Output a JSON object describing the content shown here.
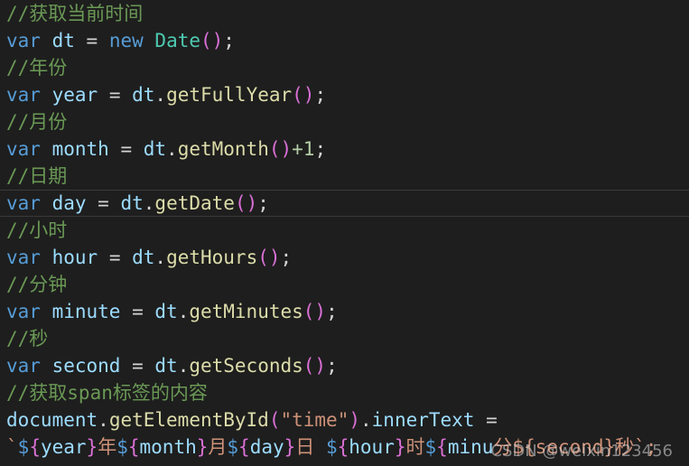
{
  "colors": {
    "background": "#1e1e1e",
    "comment": "#6a9955",
    "keyword": "#569cd6",
    "variable": "#9cdcfe",
    "function": "#dcdcaa",
    "class": "#4ec9b0",
    "number": "#b5cea8",
    "string": "#ce9178",
    "bracket": "#da70d6"
  },
  "code": {
    "comment_now": "//获取当前时间",
    "kw_var": "var",
    "kw_new": "new",
    "dt": "dt",
    "eq": " = ",
    "dot": ".",
    "semi": ";",
    "parens": "()",
    "date_class": "Date",
    "comment_year": "//年份",
    "year": "year",
    "getFullYear": "getFullYear",
    "comment_month": "//月份",
    "month": "month",
    "getMonth": "getMonth",
    "plus_one": "+1",
    "comment_day": "//日期",
    "day": "day",
    "getDate": "getDate",
    "comment_hour": "//小时",
    "hour": "hour",
    "getHours": "getHours",
    "comment_minute": "//分钟",
    "minute": "minute",
    "getMinutes": "getMinutes",
    "comment_second": "//秒",
    "second": "second",
    "getSeconds": "getSeconds",
    "comment_span": "//获取span标签的内容",
    "document": "document",
    "getElementById": "getElementById",
    "open_paren": "(",
    "close_paren": ")",
    "time_string": "\"time\"",
    "innerText": "innerText",
    "eq_trail": " =",
    "backtick": "`",
    "dollar": "$",
    "lbrace": "{",
    "rbrace": "}",
    "tpl_year_unit": "年",
    "tpl_month_unit": "月",
    "tpl_day_unit": "日 ",
    "tpl_hour_unit": "时",
    "tpl_minute_partial": "minu",
    "tpl_tail": "分${second}秒`;"
  },
  "watermark": "CSDN @weixin123456"
}
